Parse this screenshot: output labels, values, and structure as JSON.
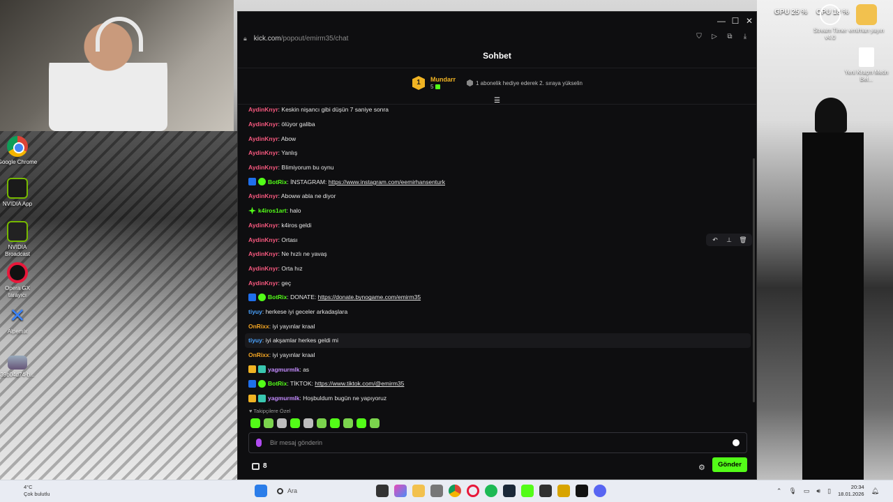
{
  "browser": {
    "url_host": "kick.com",
    "url_path": "/popout/emirm35/chat"
  },
  "chat": {
    "title": "Sohbet",
    "pinned": {
      "rank": "1",
      "username": "Mundarr",
      "count": "5",
      "promo": "1 abonelik hediye ederek 2. sıraya yükselin"
    },
    "messages": [
      {
        "user": "AydinKnyr",
        "color": "#f6587e",
        "text": ": Keskin nişancı gibi düşün 7 saniye sonra",
        "badges": []
      },
      {
        "user": "AydinKnyr",
        "color": "#f6587e",
        "text": ": ölüyor galiba",
        "badges": []
      },
      {
        "user": "AydinKnyr",
        "color": "#f6587e",
        "text": ": Abow",
        "badges": []
      },
      {
        "user": "AydinKnyr",
        "color": "#f6587e",
        "text": ": Yanlış",
        "badges": []
      },
      {
        "user": "AydinKnyr",
        "color": "#f6587e",
        "text": ": BIimiyorum bu oynu",
        "badges": []
      },
      {
        "user": "BotRix",
        "color": "#53fc18",
        "text": ": İNSTAGRAM: ",
        "link": "https://www.instagram.com/eemirhansenturk",
        "badges": [
          "bot",
          "verified"
        ]
      },
      {
        "user": "AydinKnyr",
        "color": "#f6587e",
        "text": ": Aboww abla ne diyor",
        "badges": []
      },
      {
        "user": "k4iros1art",
        "color": "#53fc18",
        "text": ": halo",
        "badges": [
          "spark"
        ]
      },
      {
        "user": "AydinKnyr",
        "color": "#f6587e",
        "text": ": k4iros geldi",
        "badges": []
      },
      {
        "user": "AydinKnyr",
        "color": "#f6587e",
        "text": ": Ortası",
        "badges": []
      },
      {
        "user": "AydinKnyr",
        "color": "#f6587e",
        "text": ": Ne hızlı ne yavaş",
        "badges": []
      },
      {
        "user": "AydinKnyr",
        "color": "#f6587e",
        "text": ": Orta hız",
        "badges": []
      },
      {
        "user": "AydinKnyr",
        "color": "#f6587e",
        "text": ": geç",
        "badges": []
      },
      {
        "user": "BotRix",
        "color": "#53fc18",
        "text": ": DONATE: ",
        "link": "https://donate.bynogame.com/emirm35",
        "badges": [
          "bot",
          "verified"
        ]
      },
      {
        "user": "tiyuy",
        "color": "#4aa3ff",
        "text": ": herkese iyi geceler arkadaşlara",
        "badges": []
      },
      {
        "user": "OnRixx",
        "color": "#f5a623",
        "text": ": iyi yayınlar kraal",
        "badges": []
      },
      {
        "user": "tiyuy",
        "color": "#4aa3ff",
        "text": ": iyi akşamlar herkes geldi mi",
        "badges": [],
        "highlight": true
      },
      {
        "user": "OnRixx",
        "color": "#f5a623",
        "text": ": iyi yayınlar kraal",
        "badges": []
      },
      {
        "user": "yagmurmlk",
        "color": "#c38bff",
        "text": ": as",
        "badges": [
          "crown",
          "sub"
        ]
      },
      {
        "user": "BotRix",
        "color": "#53fc18",
        "text": ": TİKTOK: ",
        "link": "https://www.tiktok.com/@emirm35",
        "badges": [
          "bot",
          "verified"
        ]
      },
      {
        "user": "yagmurmlk",
        "color": "#c38bff",
        "text": ": Hoşbuldum bugün ne yapıyoruz",
        "badges": [
          "crown",
          "sub"
        ]
      }
    ],
    "emote_section_label": "Takipçilere Özel",
    "input_placeholder": "Bir mesaj gönderin",
    "points": "8",
    "send_label": "Gönder",
    "accent_color": "#53fc18"
  },
  "desktop": {
    "icons": [
      {
        "label": "Google Chrome",
        "glyph": "chrome-icon"
      },
      {
        "label": "NVIDIA App",
        "glyph": "nvidia-icon"
      },
      {
        "label": "NVIDIA Broadcast",
        "glyph": "broadcast-icon"
      },
      {
        "label": "Opera GX tarayıcı",
        "glyph": "opera-icon"
      },
      {
        "label": "Alpemix",
        "glyph": "alpemix-icon"
      },
      {
        "label": "39b04d74-b...",
        "glyph": "image-file-icon"
      }
    ],
    "right_icons": [
      {
        "label": "Stream Timer v4.0",
        "glyph": "timer-icon"
      },
      {
        "label": "emirhan yayın",
        "glyph": "folder-icon"
      },
      {
        "label": "Yeni Kraçm Metin Bel...",
        "glyph": "document-icon"
      }
    ],
    "gpu": "GPU 25 %",
    "cpu": "CPU 18 %"
  },
  "taskbar": {
    "temperature": "4°C",
    "weather": "Çok bulutlu",
    "search": "Ara",
    "time": "20:34",
    "date": "18.01.2026"
  }
}
